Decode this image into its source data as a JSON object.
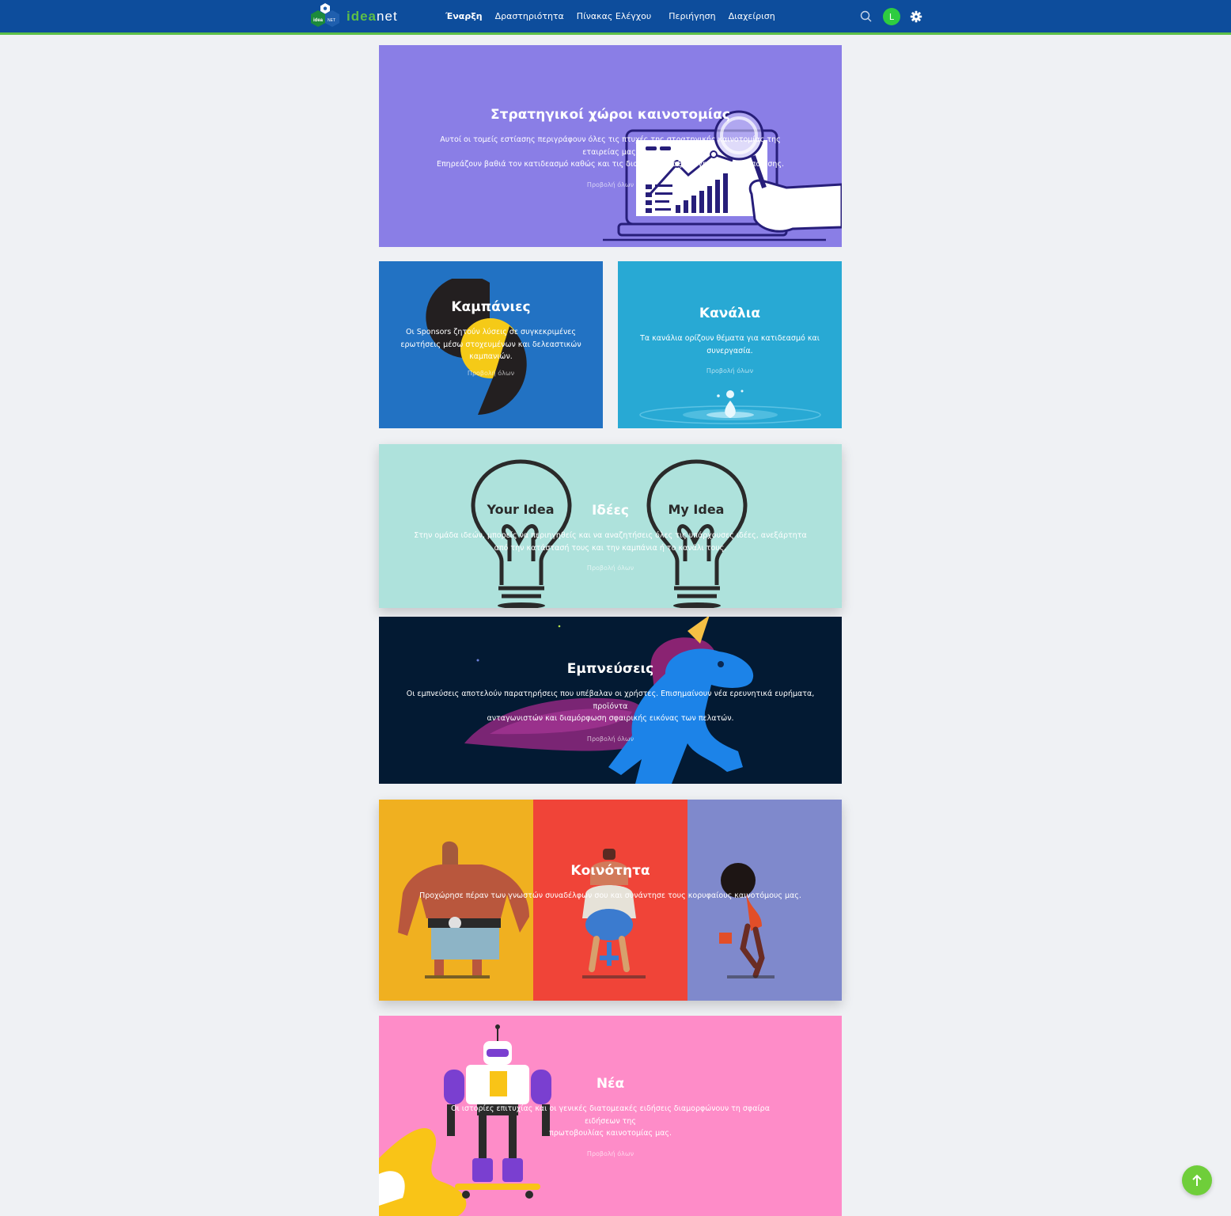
{
  "header": {
    "logo_idea": "idea",
    "logo_net": "net",
    "logo_badge_text": "idea",
    "logo_badge_net": "NET",
    "nav": [
      "Έναρξη",
      "Δραστηριότητα",
      "Πίνακας Ελέγχου",
      "Περιήγηση",
      "Διαχείριση"
    ],
    "active_nav": "Έναρξη",
    "avatar_initial": "L",
    "icons": [
      "search-icon",
      "gear-icon"
    ]
  },
  "cards": {
    "strategic": {
      "title": "Στρατηγικοί χώροι καινοτομίας",
      "desc_line1": "Αυτοί οι τομείς εστίασης περιγράφουν όλες τις πτυχές της στρατηγικής καινοτομίας της εταιρείας μας.",
      "desc_line2": "Επηρεάζουν βαθιά τον κατιδεασμό καθώς και τις διαδικασίες αξιολόγησης και υλοποίησης.",
      "view_all": "Προβολή όλων",
      "bg": "#8a7ee6"
    },
    "campaigns": {
      "title": "Καμπάνιες",
      "desc_line1": "Οι Sponsors ζητούν λύσεις σε συγκεκριμένες",
      "desc_line2": "ερωτήσεις μέσω στοχευμένων και δελεαστικών",
      "desc_line3": "καμπανιών.",
      "view_all": "Προβολή όλων",
      "bg": "#2272c3"
    },
    "channels": {
      "title": "Κανάλια",
      "desc_line1": "Τα κανάλια ορίζουν θέματα για κατιδεασμό και",
      "desc_line2": "συνεργασία.",
      "view_all": "Προβολή όλων",
      "bg": "#28a9d4"
    },
    "ideas": {
      "title": "Ιδέες",
      "desc_line1": "Στην ομάδα ιδεών, μπορείς να περιηγηθείς και να αναζητήσεις όλες τις υπάρχουσες ιδέες, ανεξάρτητα",
      "desc_line2": "από την κατάστασή τους και την καμπάνια ή το κανάλι τους.",
      "view_all": "Προβολή όλων",
      "bulb_left": "Your Idea",
      "bulb_right": "My Idea",
      "bg": "#aee2dc"
    },
    "inspirations": {
      "title": "Εμπνεύσεις",
      "desc_line1": "Οι εμπνεύσεις αποτελούν παρατηρήσεις που υπέβαλαν οι χρήστες. Επισημαίνουν νέα ερευνητικά ευρήματα, προϊόντα",
      "desc_line2": "ανταγωνιστών και διαμόρφωση σφαιρικής εικόνας των πελατών.",
      "view_all": "Προβολή όλων",
      "bg": "#031a33"
    },
    "community": {
      "title": "Κοινότητα",
      "desc_line1": "Προχώρησε πέραν των γνωστών συναδέλφων σου και συνάντησε τους κορυφαίους καινοτόμους μας.",
      "colors": [
        "#f0b020",
        "#f04438",
        "#7f89cc"
      ]
    },
    "news": {
      "title": "Νέα",
      "desc_line1": "Οι ιστορίες επιτυχίας και οι γενικές διατομεακές ειδήσεις διαμορφώνουν τη σφαίρα ειδήσεων της",
      "desc_line2": "πρωτοβουλίας καινοτομίας μας.",
      "view_all": "Προβολή όλων",
      "bg": "#fe8cc8"
    }
  },
  "scroll_top_icon": "arrow-up-icon"
}
